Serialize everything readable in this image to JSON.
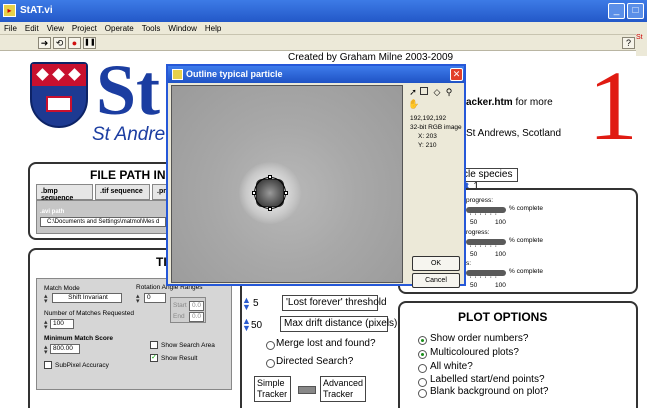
{
  "window": {
    "title": "StAT.vi",
    "minimize": "_",
    "maximize": "□"
  },
  "menu": [
    "File",
    "Edit",
    "View",
    "Project",
    "Operate",
    "Tools",
    "Window",
    "Help"
  ],
  "toolbar": {
    "run_symbol": "➜",
    "run_continuous_symbol": "⟲",
    "abort_symbol": "●",
    "pause_symbol": "❚❚",
    "help_symbol": "?"
  },
  "logo": {
    "big_text": "St",
    "subtitle": "St Andrews",
    "big_one": "1"
  },
  "header": {
    "credit": "Created by Graham Milne 2003-2009",
    "tracker_link_bold": "acker.htm",
    "tracker_link_rest": " for more",
    "location_line1": "St Andrews, Scotland",
    "location_line2": ""
  },
  "right_edge_text": "St",
  "file_panel": {
    "title": "FILE PATH INP",
    "tabs": [
      ".bmp sequence",
      ".tif sequence",
      ".png"
    ],
    "path_label": ".avi path",
    "path_value": "C:\\Documents and Settings\\matmol\\Mes d"
  },
  "tracking_panel": {
    "title": "TI",
    "match_mode_label": "Match Mode",
    "match_mode_value": "Shift Invariant",
    "rotation_label": "Rotation Angle Ranges",
    "rotation_value": "0",
    "start_label": "Start",
    "start_value": "0.0",
    "end_label": "End",
    "end_value": "0.0",
    "num_matches_label": "Number of Matches Requested",
    "num_matches_value": "100",
    "min_score_label": "Minimum Match Score",
    "min_score_value": "800.00",
    "show_search_area": "Show Search Area",
    "show_result": "Show Result",
    "subpixel": "SubPixel Accuracy"
  },
  "middle_controls": {
    "lost_forever_value": "5",
    "lost_forever_label": "'Lost forever' threshold",
    "max_drift_value": "50",
    "max_drift_label": "Max drift distance (pixels)",
    "merge_label": "Merge lost and found?",
    "directed_label": "Directed Search?",
    "simple_tracker_line1": "Simple",
    "simple_tracker_line2": "Tracker",
    "advanced_tracker_line1": "Advanced",
    "advanced_tracker_line2": "Tracker"
  },
  "species": {
    "label": "cle species",
    "value": "1"
  },
  "progress_panel": {
    "rows": [
      {
        "label": "progress:",
        "complete": "% complete",
        "ticks": "' ' ' ' ' '",
        "scale_mid": "50",
        "scale_max": "100"
      },
      {
        "label": "rogress:",
        "complete": "% complete",
        "ticks": "' ' ' ' ' '",
        "scale_mid": "50",
        "scale_max": "100"
      },
      {
        "label": "s:",
        "complete": "% complete",
        "ticks": "' ' ' ' ' '",
        "scale_mid": "50",
        "scale_max": "100"
      }
    ]
  },
  "plot_options": {
    "title": "PLOT OPTIONS",
    "options": [
      {
        "label": "Show order numbers?",
        "selected": true
      },
      {
        "label": "Multicoloured plots?",
        "selected": true
      },
      {
        "label": "All white?",
        "selected": false
      },
      {
        "label": "Labelled start/end points?",
        "selected": false
      },
      {
        "label": "Blank background on plot?",
        "selected": false
      }
    ]
  },
  "dialog": {
    "title": "Outline typical particle",
    "close": "✕",
    "pixel_value": "192,192,192",
    "image_type": "32-bit RGB image",
    "x_label": "X:",
    "x_value": "203",
    "y_label": "Y:",
    "y_value": "210",
    "ok": "OK",
    "cancel": "Cancel",
    "tools": [
      "arrow-tool",
      "rectangle-tool",
      "polygon-tool",
      "zoom-tool",
      "pan-tool"
    ]
  }
}
